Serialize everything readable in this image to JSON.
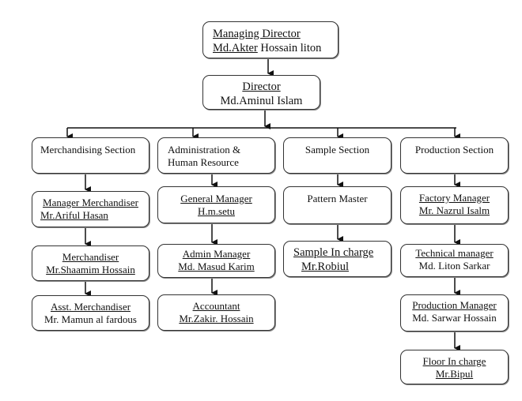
{
  "top": {
    "managing_director": {
      "title": "Managing Director",
      "name": "Md.Akter Hossain liton"
    },
    "director": {
      "title": "Director",
      "name": "Md.Aminul Islam"
    }
  },
  "sections": [
    {
      "label": "Merchandising Section",
      "members": [
        {
          "title": "Manager Merchandiser",
          "name": "Mr.Ariful Hasan"
        },
        {
          "title": "Merchandiser",
          "name": "Mr.Shaamim Hossain"
        },
        {
          "title": "Asst. Merchandiser",
          "name": "Mr. Mamun al fardous"
        }
      ]
    },
    {
      "label_line1": "Administration &",
      "label_line2": "Human Resource",
      "members": [
        {
          "title": "General Manager",
          "name": "H.m.setu"
        },
        {
          "title": "Admin Manager",
          "name": "Md. Masud Karim"
        },
        {
          "title": "Accountant",
          "name": "Mr.Zakir. Hossain"
        }
      ]
    },
    {
      "label": "Sample Section",
      "members": [
        {
          "title": "Pattern Master"
        },
        {
          "title": "Sample In charge",
          "name": "Mr.Robiul"
        }
      ]
    },
    {
      "label": "Production Section",
      "members": [
        {
          "title": "Factory Manager",
          "name": "Mr. Nazrul Isalm"
        },
        {
          "title": "Technical manager",
          "name": "Md. Liton Sarkar"
        },
        {
          "title": "Production Manager",
          "name": "Md. Sarwar Hossain"
        },
        {
          "title": "Floor In charge",
          "name": "Mr.Bipul"
        }
      ]
    }
  ]
}
